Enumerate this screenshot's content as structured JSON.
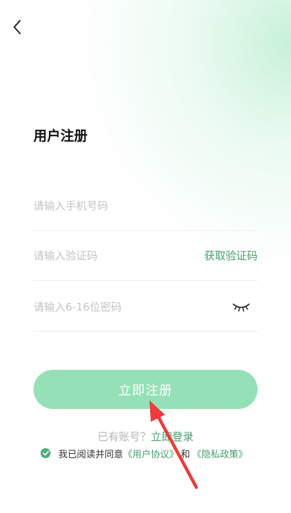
{
  "header": {
    "back_icon": "chevron-left-icon"
  },
  "title": "用户注册",
  "form": {
    "phone_placeholder": "请输入手机号码",
    "code_placeholder": "请输入验证码",
    "get_code_label": "获取验证码",
    "password_placeholder": "请输入6-16位密码",
    "password_toggle_icon": "eye-closed-icon"
  },
  "register_button": "立即注册",
  "login_prompt": {
    "question": "已有账号？",
    "link": "立即登录"
  },
  "agreement": {
    "prefix": "我已阅读并同意",
    "user_agreement": "《用户协议》",
    "conjunction": "和",
    "privacy_policy": "《隐私政策》",
    "checked": true
  },
  "annotation": {
    "arrow_icon": "red-arrow-icon",
    "arrow_color": "#ee3b3b"
  },
  "colors": {
    "accent": "#46a06b",
    "button_bg": "#96e0b7",
    "placeholder": "#c4c4c4"
  }
}
